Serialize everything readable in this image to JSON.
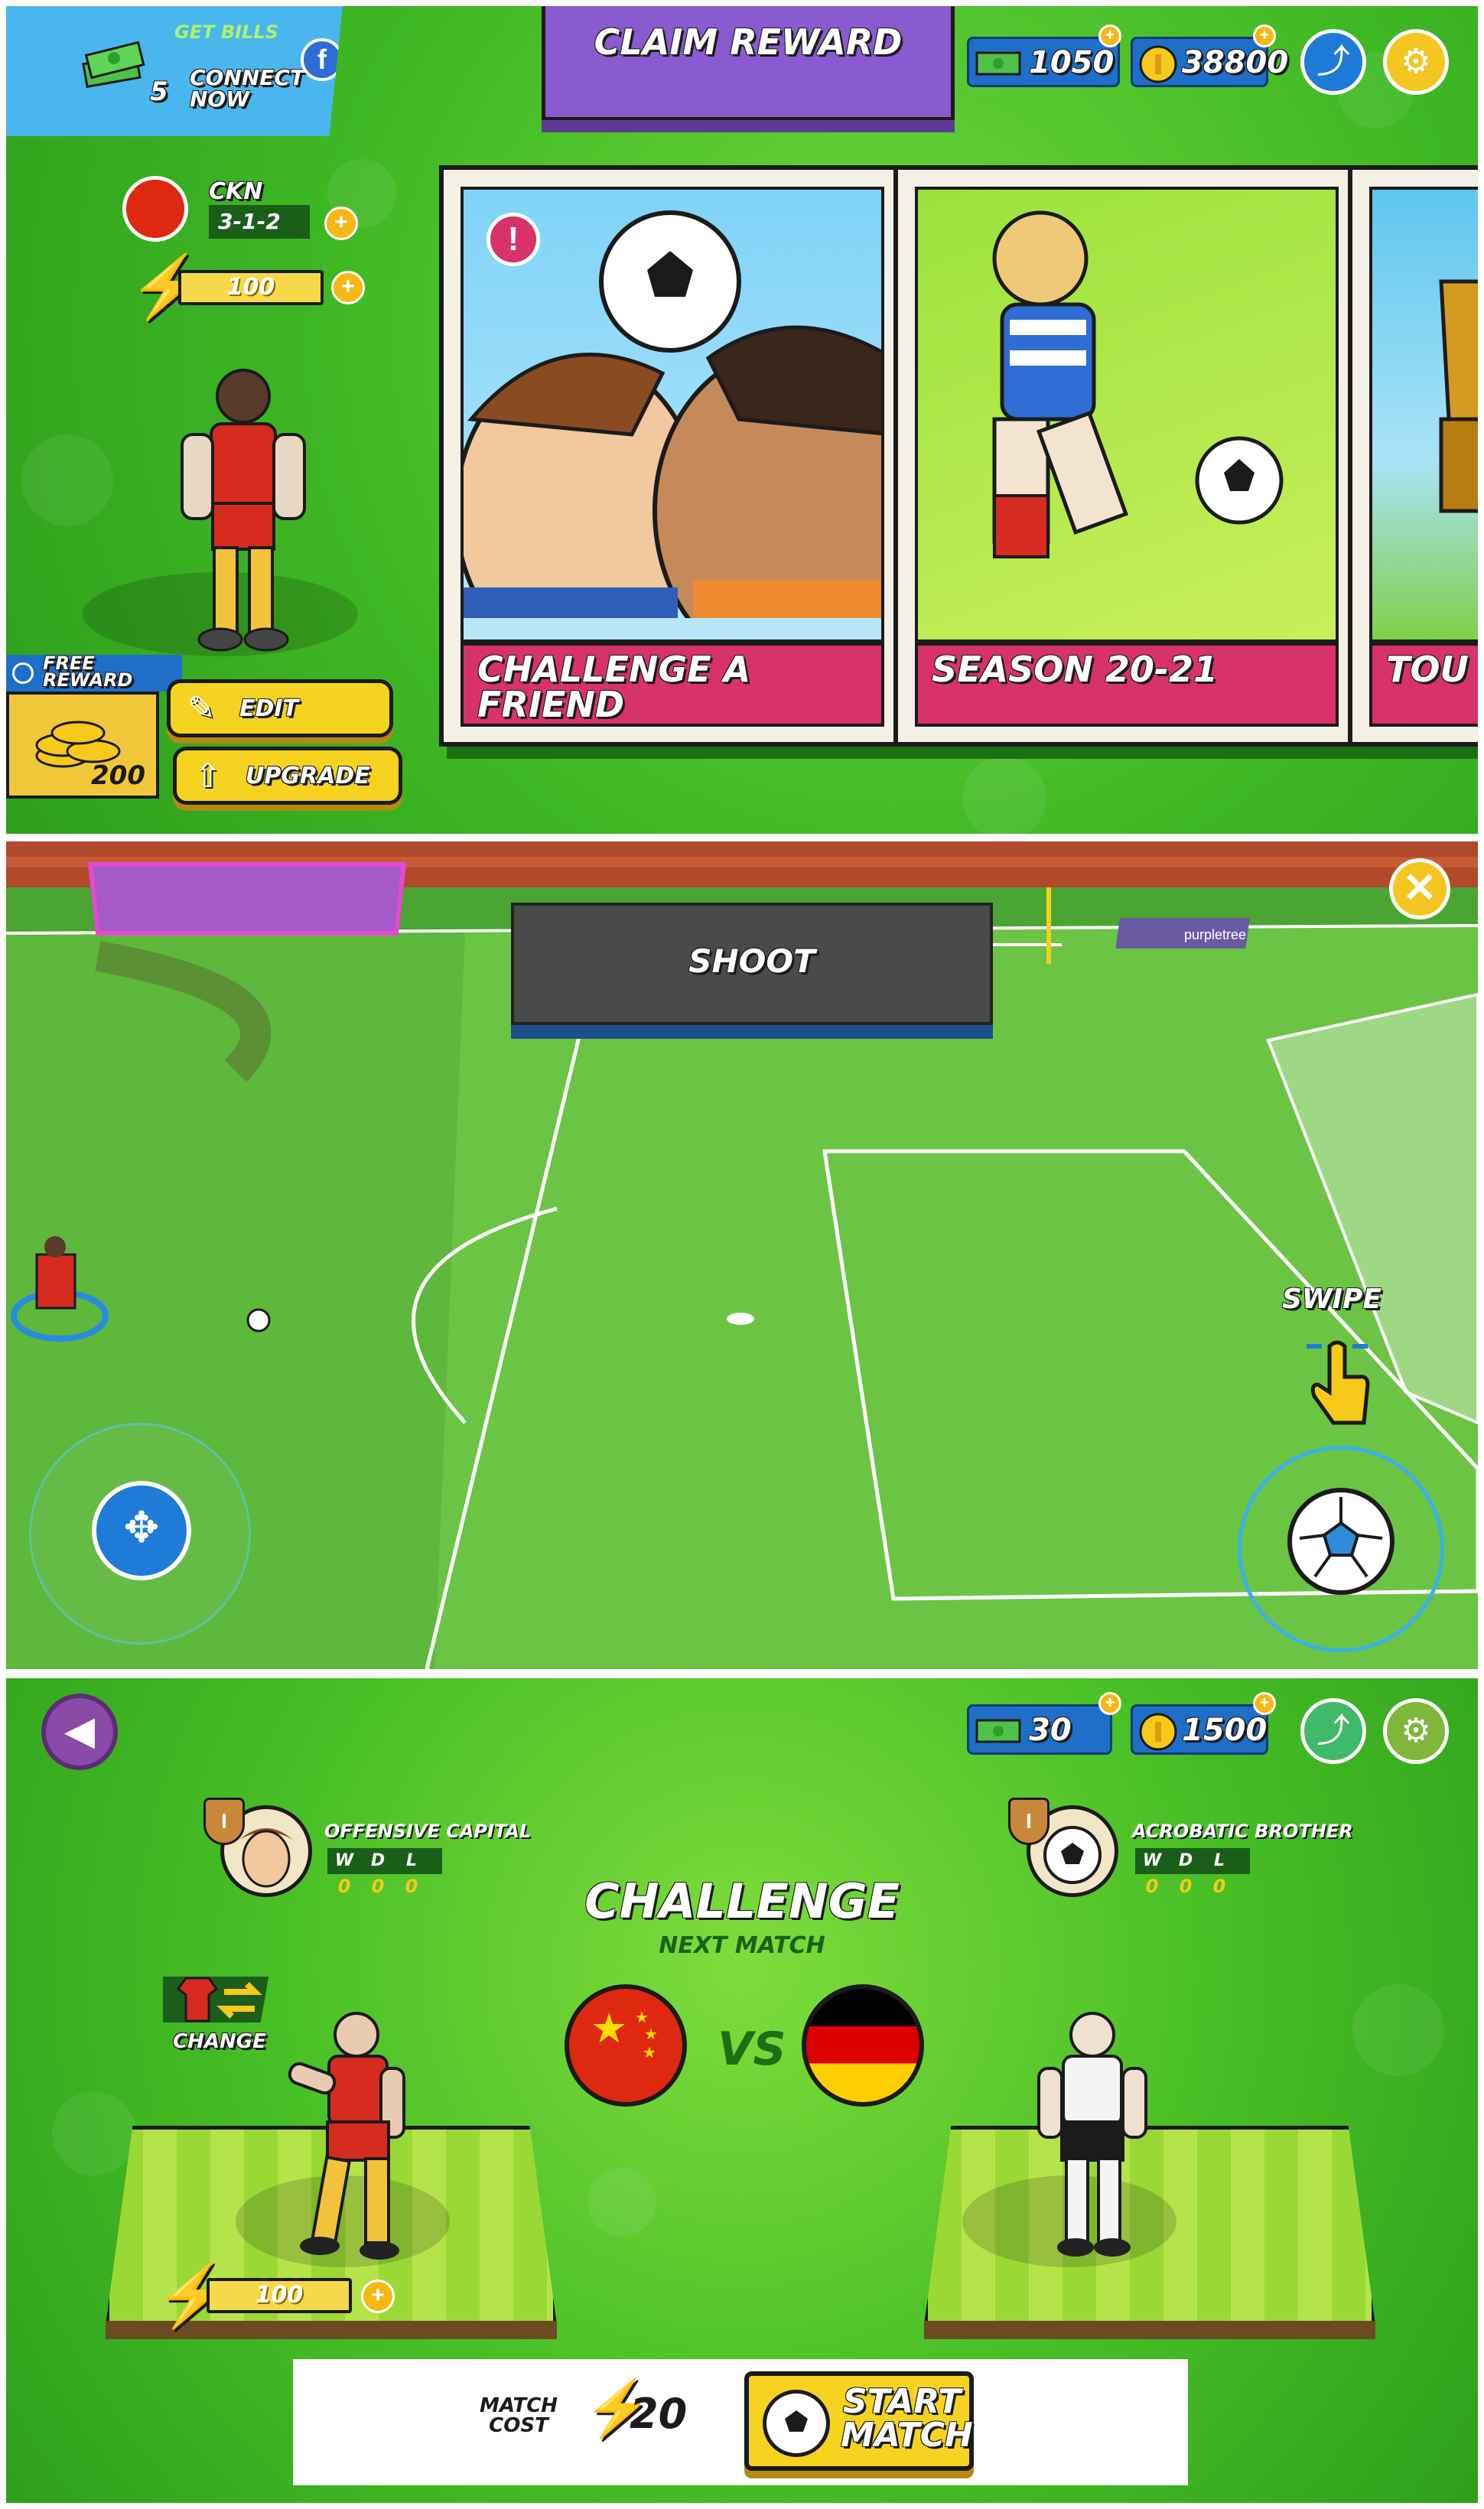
{
  "home": {
    "get_bills": "GET BILLS",
    "connect_now": "CONNECT NOW",
    "bills_count": "5",
    "claim_reward": "CLAIM REWARD",
    "cash": "1050",
    "coins": "38800",
    "team_code": "CKN",
    "formation": "3-1-2",
    "energy": "100",
    "free_reward": "FREE REWARD",
    "free_reward_amount": "200",
    "edit_label": "EDIT",
    "upgrade_label": "UPGRADE",
    "cards": [
      {
        "title": "CHALLENGE A FRIEND"
      },
      {
        "title": "SEASON 20-21"
      },
      {
        "title": "TOU"
      }
    ]
  },
  "gameplay": {
    "shoot_label": "SHOOT",
    "swipe_label": "SWIPE",
    "sponsor_sign": "purpletree"
  },
  "challenge": {
    "cash": "30",
    "coins": "1500",
    "title": "CHALLENGE",
    "subtitle": "NEXT MATCH",
    "vs": "VS",
    "change_label": "CHANGE",
    "home_player": {
      "name": "OFFENSIVE CAPITAL",
      "w": "0",
      "d": "0",
      "l": "0"
    },
    "away_player": {
      "name": "ACROBATIC BROTHER",
      "w": "0",
      "d": "0",
      "l": "0"
    },
    "wdl_headers": [
      "W",
      "D",
      "L"
    ],
    "energy": "100",
    "match_cost_label": "MATCH COST",
    "match_cost": "20",
    "start_match": "START MATCH"
  },
  "colors": {
    "green": "#3fb824",
    "purple": "#8a5ad0",
    "pink": "#d8326b",
    "yellow": "#f6d320",
    "blue": "#1f6fc9"
  },
  "icons": [
    "facebook-icon",
    "share-icon",
    "settings-icon",
    "plus-icon",
    "lightning-icon",
    "edit-icon",
    "upgrade-icon",
    "alert-icon",
    "close-icon",
    "dpad-icon",
    "swipe-hand-icon",
    "back-icon",
    "swap-icon",
    "soccer-ball-icon"
  ]
}
